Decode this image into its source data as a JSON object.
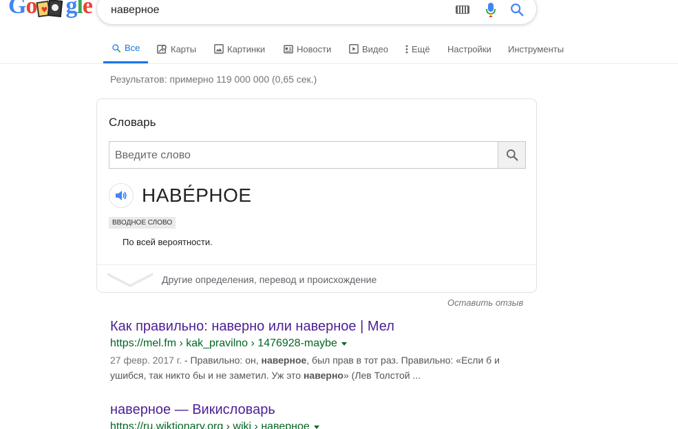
{
  "search": {
    "query": "наверное"
  },
  "tabs": [
    {
      "label": "Все",
      "icon": "search-icon",
      "active": true
    },
    {
      "label": "Карты",
      "icon": "map-icon"
    },
    {
      "label": "Картинки",
      "icon": "image-icon"
    },
    {
      "label": "Новости",
      "icon": "news-icon"
    },
    {
      "label": "Видео",
      "icon": "video-icon"
    },
    {
      "label": "Ещё",
      "icon": "more-vert-icon"
    },
    {
      "label": "Настройки"
    },
    {
      "label": "Инструменты"
    }
  ],
  "results_stats": "Результатов: примерно 119 000 000 (0,65 сек.) ",
  "dictionary": {
    "title": "Словарь",
    "search_placeholder": "Введите слово",
    "headword": "НАВЕ́РНОЕ",
    "part_of_speech": "вводное слово",
    "definition": "По всей вероятности.",
    "more_link": "Другие определения, перевод и происхождение"
  },
  "feedback": "Оставить отзыв",
  "results": [
    {
      "title": "Как правильно: наверно или наверное | Мел",
      "url": "https://mel.fm › kak_pravilno › 1476928-maybe",
      "date": "27 февр. 2017 г.",
      "snippet_parts": [
        " - Правильно: он, ",
        "наверное",
        ", был прав в тот раз. Правильно: «Если б и ушибся, так никто бы и не заметил. Уж это ",
        "наверно",
        "» (Лев Толстой ..."
      ]
    },
    {
      "title": "наверное — Викисловарь",
      "url": "https://ru.wiktionary.org › wiki › наверное"
    }
  ],
  "colors": {
    "link_visited": "#4c1e95",
    "url_green": "#006621",
    "active_tab": "#1a73e8"
  }
}
